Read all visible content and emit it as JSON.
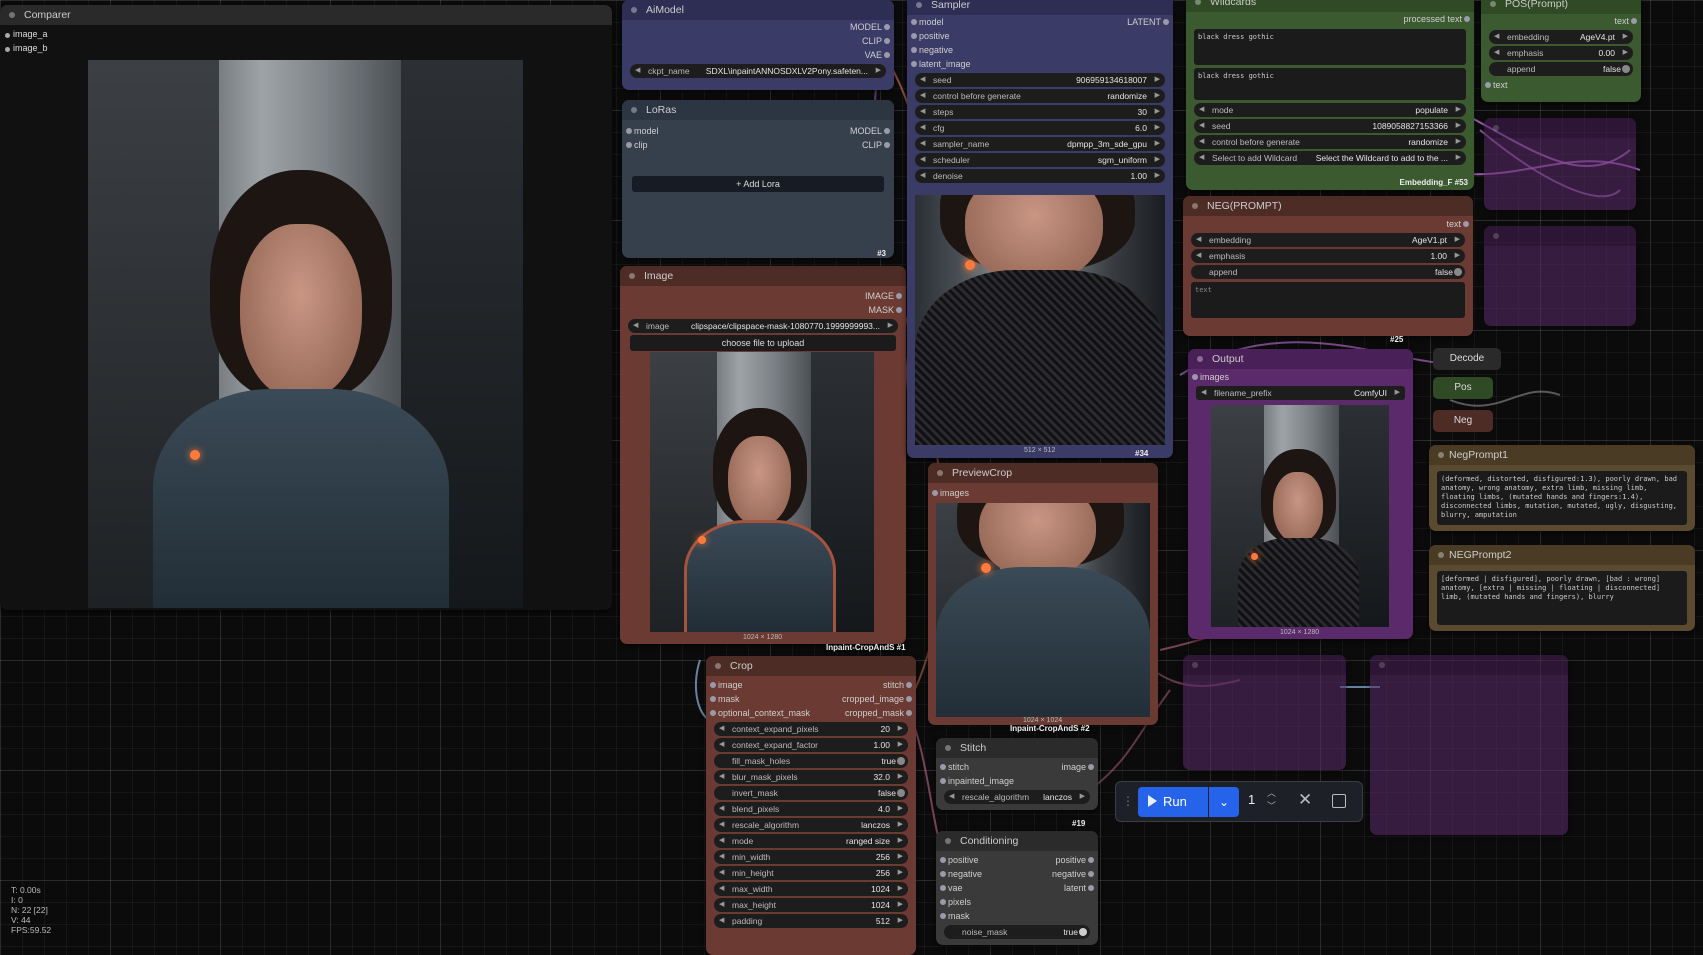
{
  "comparer": {
    "title": "Comparer",
    "inputs": [
      "image_a",
      "image_b"
    ]
  },
  "aimodel": {
    "title": "AiModel",
    "outputs": [
      "MODEL",
      "CLIP",
      "VAE"
    ],
    "ckpt_key": "ckpt_name",
    "ckpt_val": "SDXL\\inpaintANNOSDXLV2Pony.safeten..."
  },
  "loras": {
    "title": "LoRas",
    "in_model": "model",
    "in_clip": "clip",
    "out_model": "MODEL",
    "out_clip": "CLIP",
    "add_lora": "+ Add Lora",
    "tag": "#3"
  },
  "image_node": {
    "title": "Image",
    "outputs": [
      "IMAGE",
      "MASK"
    ],
    "image_key": "image",
    "image_val": "clipspace/clipspace-mask-1080770.1999999993...",
    "upload": "choose file to upload",
    "dims": "1024 × 1280",
    "tag": "Inpaint-CropAndS #1"
  },
  "sampler": {
    "title": "Sampler",
    "inputs": [
      "model",
      "positive",
      "negative",
      "latent_image"
    ],
    "output": "LATENT",
    "widgets": [
      [
        "seed",
        "906959134618007"
      ],
      [
        "control before generate",
        "randomize"
      ],
      [
        "steps",
        "30"
      ],
      [
        "cfg",
        "6.0"
      ],
      [
        "sampler_name",
        "dpmpp_3m_sde_gpu"
      ],
      [
        "scheduler",
        "sgm_uniform"
      ],
      [
        "denoise",
        "1.00"
      ]
    ],
    "dims": "512 × 512",
    "tag": "#34"
  },
  "wildcards": {
    "title": "Wildcards",
    "output": "processed text",
    "text1": "black dress gothic",
    "text2": "black dress gothic",
    "widgets": [
      [
        "mode",
        "populate"
      ],
      [
        "seed",
        "1089058827153366"
      ],
      [
        "control before generate",
        "randomize"
      ],
      [
        "Select to add Wildcard",
        "Select the Wildcard to add to the ..."
      ]
    ],
    "tag": "Embedding_F #53"
  },
  "pos": {
    "title": "POS(Prompt)",
    "in": "text",
    "out": "text",
    "widgets": [
      [
        "embedding",
        "AgeV4.pt"
      ],
      [
        "emphasis",
        "0.00"
      ]
    ],
    "append_key": "append",
    "append_val": "false",
    "label": "text"
  },
  "neg": {
    "title": "NEG(PROMPT)",
    "out": "text",
    "widgets": [
      [
        "embedding",
        "AgeV1.pt"
      ],
      [
        "emphasis",
        "1.00"
      ]
    ],
    "append_key": "append",
    "append_val": "false",
    "text": "text",
    "tag": "#25"
  },
  "output": {
    "title": "Output",
    "input": "images",
    "prefix_key": "filename_prefix",
    "prefix_val": "ComfyUI",
    "dims": "1024 × 1280"
  },
  "previewcrop": {
    "title": "PreviewCrop",
    "input": "images",
    "dims": "1024 × 1024",
    "tag": "Inpaint-CropAndS #2"
  },
  "crop": {
    "title": "Crop",
    "inputs": [
      "image",
      "mask",
      "optional_context_mask"
    ],
    "outputs": [
      "stitch",
      "cropped_image",
      "cropped_mask"
    ],
    "widgets": [
      [
        "context_expand_pixels",
        "20"
      ],
      [
        "context_expand_factor",
        "1.00"
      ],
      [
        "fill_mask_holes",
        "true",
        "tg"
      ],
      [
        "blur_mask_pixels",
        "32.0"
      ],
      [
        "invert_mask",
        "false",
        "tg"
      ],
      [
        "blend_pixels",
        "4.0"
      ],
      [
        "rescale_algorithm",
        "lanczos"
      ],
      [
        "mode",
        "ranged size"
      ],
      [
        "min_width",
        "256"
      ],
      [
        "min_height",
        "256"
      ],
      [
        "max_width",
        "1024"
      ],
      [
        "max_height",
        "1024"
      ],
      [
        "padding",
        "512"
      ]
    ]
  },
  "stitch": {
    "title": "Stitch",
    "inputs": [
      "stitch",
      "inpainted_image"
    ],
    "output": "image",
    "widget": [
      "rescale_algorithm",
      "lanczos"
    ],
    "tag": "#19"
  },
  "conditioning": {
    "title": "Conditioning",
    "inputs": [
      "positive",
      "negative",
      "vae",
      "pixels",
      "mask"
    ],
    "outputs": [
      "positive",
      "negative",
      "latent"
    ],
    "widget": [
      "noise_mask",
      "true"
    ]
  },
  "reroutes": {
    "decode": "Decode",
    "pos": "Pos",
    "neg": "Neg"
  },
  "negprompt1": {
    "title": "NegPrompt1",
    "text": "(deformed, distorted, disfigured:1.3), poorly drawn, bad anatomy, wrong anatomy, extra limb, missing limb, floating limbs, (mutated hands and fingers:1.4), disconnected limbs, mutation, mutated, ugly, disgusting, blurry, amputation"
  },
  "negprompt2": {
    "title": "NEGPrompt2",
    "text": "[deformed | disfigured], poorly drawn, [bad : wrong] anatomy, [extra | missing | floating | disconnected] limb, (mutated hands and fingers), blurry"
  },
  "runbar": {
    "run": "Run",
    "count": "1"
  },
  "stats": [
    "T: 0.00s",
    "I: 0",
    "N: 22 [22]",
    "V: 44",
    "FPS:59.52"
  ],
  "colors": {
    "run_button": "#2563eb",
    "node_blue": "#3b3b67",
    "node_brown": "#6b3a32",
    "node_green": "#3c5a2f",
    "node_purple": "#5a2a6a"
  }
}
